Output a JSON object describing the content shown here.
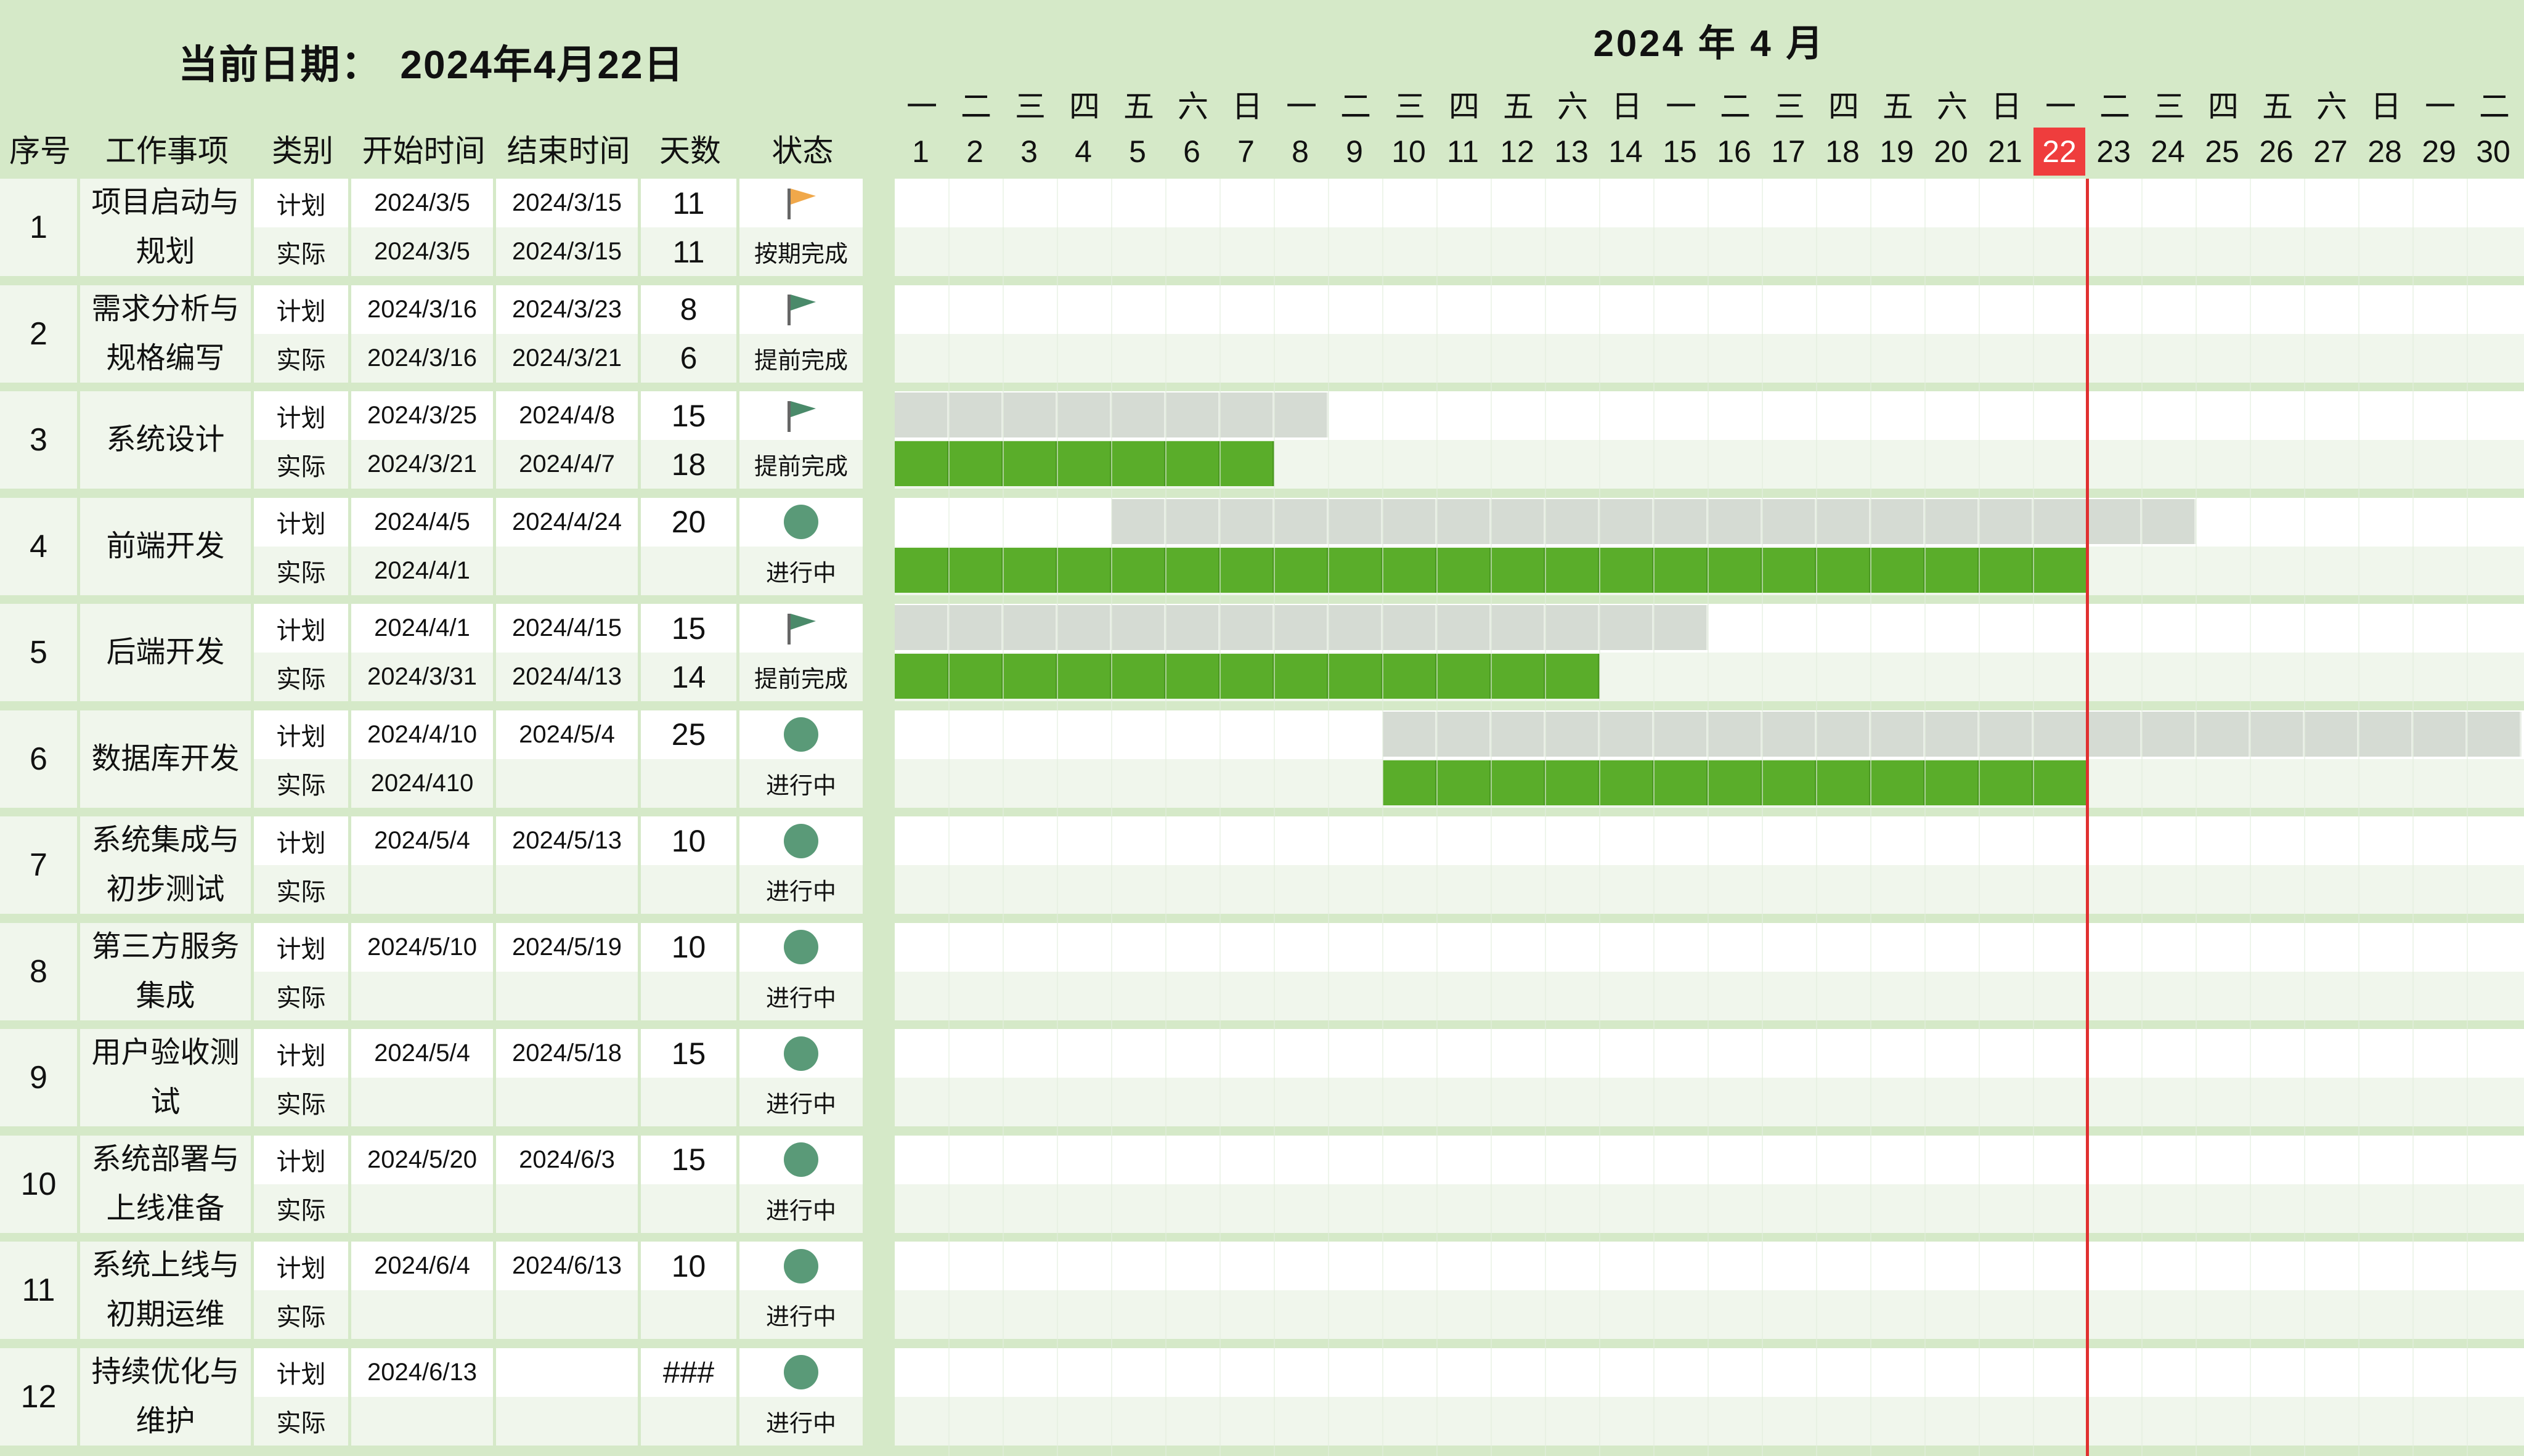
{
  "header": {
    "current_date_label": "当前日期：",
    "current_date_value": "2024年4月22日",
    "month_title": "2024 年  4  月"
  },
  "columns": {
    "seq": "序号",
    "task": "工作事项",
    "type": "类别",
    "start": "开始时间",
    "end": "结束时间",
    "days": "天数",
    "status": "状态"
  },
  "calendar": {
    "weekdays": [
      "一",
      "二",
      "三",
      "四",
      "五",
      "六",
      "日",
      "一",
      "二",
      "三",
      "四",
      "五",
      "六",
      "日",
      "一",
      "二",
      "三",
      "四",
      "五",
      "六",
      "日",
      "一",
      "二",
      "三",
      "四",
      "五",
      "六",
      "日",
      "一",
      "二"
    ],
    "days": [
      "1",
      "2",
      "3",
      "4",
      "5",
      "6",
      "7",
      "8",
      "9",
      "10",
      "11",
      "12",
      "13",
      "14",
      "15",
      "16",
      "17",
      "18",
      "19",
      "20",
      "21",
      "22",
      "23",
      "24",
      "25",
      "26",
      "27",
      "28",
      "29",
      "30"
    ],
    "today": "22",
    "today_index": 21
  },
  "colors": {
    "header_bg": "#d5e9c8",
    "plan_bar": "#d5dbd3",
    "actual_bar": "#5aad2a",
    "today_line": "#e03030",
    "flag_orange": "#f0a84a",
    "flag_green": "#4a8a6a",
    "status_dot": "#5a9a78"
  },
  "tasks": [
    {
      "seq": "1",
      "name": "项目启动与规划",
      "plan_label": "计划",
      "actual_label": "实际",
      "plan_start": "2024/3/5",
      "plan_end": "2024/3/15",
      "plan_days": "11",
      "act_start": "2024/3/5",
      "act_end": "2024/3/15",
      "act_days": "11",
      "status": "按期完成",
      "icon": "flag-orange-icon",
      "plan_bar": null,
      "act_bar": null
    },
    {
      "seq": "2",
      "name": "需求分析与规格编写",
      "plan_label": "计划",
      "actual_label": "实际",
      "plan_start": "2024/3/16",
      "plan_end": "2024/3/23",
      "plan_days": "8",
      "act_start": "2024/3/16",
      "act_end": "2024/3/21",
      "act_days": "6",
      "status": "提前完成",
      "icon": "flag-green-icon",
      "plan_bar": null,
      "act_bar": null
    },
    {
      "seq": "3",
      "name": "系统设计",
      "plan_label": "计划",
      "actual_label": "实际",
      "plan_start": "2024/3/25",
      "plan_end": "2024/4/8",
      "plan_days": "15",
      "act_start": "2024/3/21",
      "act_end": "2024/4/7",
      "act_days": "18",
      "status": "提前完成",
      "icon": "flag-green-icon",
      "plan_bar": [
        1,
        8
      ],
      "act_bar": [
        1,
        7
      ]
    },
    {
      "seq": "4",
      "name": "前端开发",
      "plan_label": "计划",
      "actual_label": "实际",
      "plan_start": "2024/4/5",
      "plan_end": "2024/4/24",
      "plan_days": "20",
      "act_start": "2024/4/1",
      "act_end": "",
      "act_days": "",
      "status": "进行中",
      "icon": "status-dot-icon",
      "plan_bar": [
        5,
        24
      ],
      "act_bar": [
        1,
        22
      ]
    },
    {
      "seq": "5",
      "name": "后端开发",
      "plan_label": "计划",
      "actual_label": "实际",
      "plan_start": "2024/4/1",
      "plan_end": "2024/4/15",
      "plan_days": "15",
      "act_start": "2024/3/31",
      "act_end": "2024/4/13",
      "act_days": "14",
      "status": "提前完成",
      "icon": "flag-green-icon",
      "plan_bar": [
        1,
        15
      ],
      "act_bar": [
        1,
        13
      ]
    },
    {
      "seq": "6",
      "name": "数据库开发",
      "plan_label": "计划",
      "actual_label": "实际",
      "plan_start": "2024/4/10",
      "plan_end": "2024/5/4",
      "plan_days": "25",
      "act_start": "2024/410",
      "act_end": "",
      "act_days": "",
      "status": "进行中",
      "icon": "status-dot-icon",
      "plan_bar": [
        10,
        30
      ],
      "act_bar": [
        10,
        22
      ]
    },
    {
      "seq": "7",
      "name": "系统集成与初步测试",
      "plan_label": "计划",
      "actual_label": "实际",
      "plan_start": "2024/5/4",
      "plan_end": "2024/5/13",
      "plan_days": "10",
      "act_start": "",
      "act_end": "",
      "act_days": "",
      "status": "进行中",
      "icon": "status-dot-icon",
      "plan_bar": null,
      "act_bar": null
    },
    {
      "seq": "8",
      "name": "第三方服务集成",
      "plan_label": "计划",
      "actual_label": "实际",
      "plan_start": "2024/5/10",
      "plan_end": "2024/5/19",
      "plan_days": "10",
      "act_start": "",
      "act_end": "",
      "act_days": "",
      "status": "进行中",
      "icon": "status-dot-icon",
      "plan_bar": null,
      "act_bar": null
    },
    {
      "seq": "9",
      "name": "用户验收测试",
      "plan_label": "计划",
      "actual_label": "实际",
      "plan_start": "2024/5/4",
      "plan_end": "2024/5/18",
      "plan_days": "15",
      "act_start": "",
      "act_end": "",
      "act_days": "",
      "status": "进行中",
      "icon": "status-dot-icon",
      "plan_bar": null,
      "act_bar": null
    },
    {
      "seq": "10",
      "name": "系统部署与上线准备",
      "plan_label": "计划",
      "actual_label": "实际",
      "plan_start": "2024/5/20",
      "plan_end": "2024/6/3",
      "plan_days": "15",
      "act_start": "",
      "act_end": "",
      "act_days": "",
      "status": "进行中",
      "icon": "status-dot-icon",
      "plan_bar": null,
      "act_bar": null
    },
    {
      "seq": "11",
      "name": "系统上线与初期运维",
      "plan_label": "计划",
      "actual_label": "实际",
      "plan_start": "2024/6/4",
      "plan_end": "2024/6/13",
      "plan_days": "10",
      "act_start": "",
      "act_end": "",
      "act_days": "",
      "status": "进行中",
      "icon": "status-dot-icon",
      "plan_bar": null,
      "act_bar": null
    },
    {
      "seq": "12",
      "name": "持续优化与维护",
      "plan_label": "计划",
      "actual_label": "实际",
      "plan_start": "2024/6/13",
      "plan_end": "",
      "plan_days": "###",
      "act_start": "",
      "act_end": "",
      "act_days": "",
      "status": "进行中",
      "icon": "status-dot-icon",
      "plan_bar": null,
      "act_bar": null
    }
  ]
}
